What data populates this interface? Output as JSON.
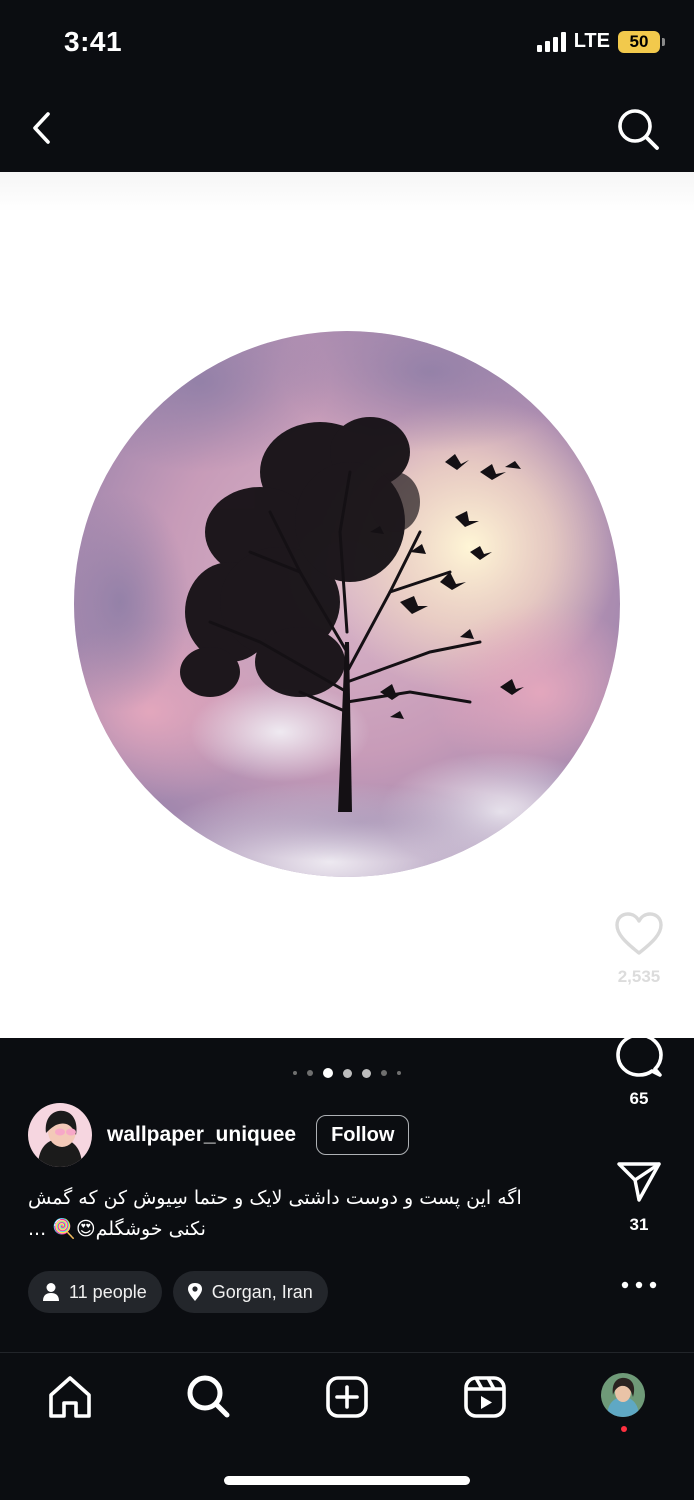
{
  "status_bar": {
    "time": "3:41",
    "network": "LTE",
    "battery": "50"
  },
  "post": {
    "likes": "2,535",
    "comments": "65",
    "shares": "31",
    "carousel": {
      "total": 7,
      "active_index": 3
    }
  },
  "author": {
    "username": "wallpaper_uniquee",
    "follow_label": "Follow"
  },
  "caption": {
    "line1": "اگه این پست و دوست داشتی لایک و حتما سِیوش کن که گمش",
    "line2": "نکنی خوشگلم😍🍭 ..."
  },
  "chips": {
    "people": "11 people",
    "location": "Gorgan, Iran"
  },
  "colors": {
    "background": "#0b0d11",
    "notification_dot": "#ff3040",
    "battery": "#f2c94c"
  }
}
